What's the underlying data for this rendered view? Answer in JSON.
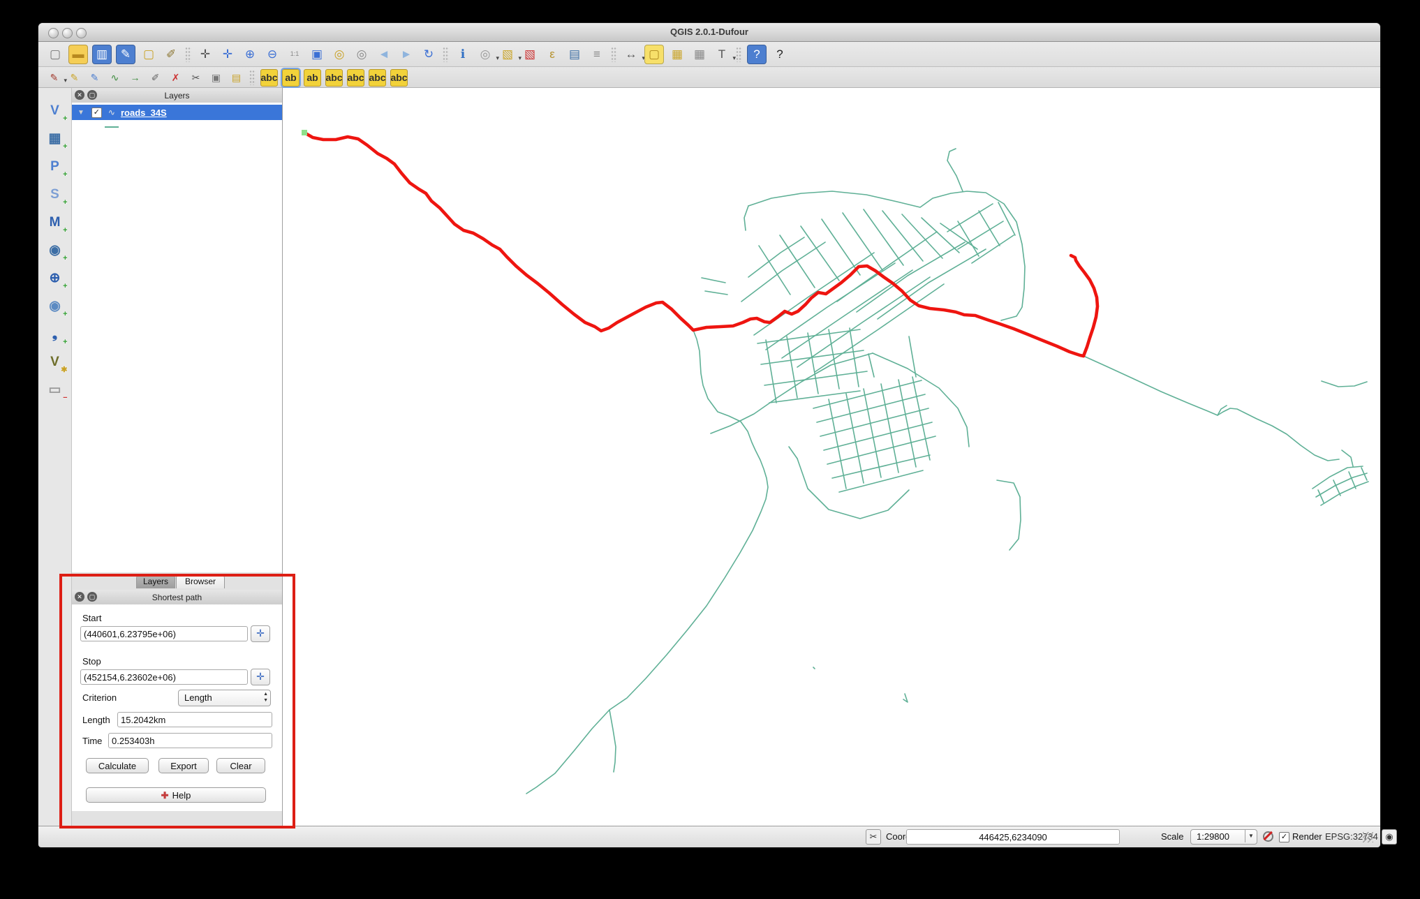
{
  "window": {
    "title": "QGIS 2.0.1-Dufour"
  },
  "colors": {
    "road": "#5fb096",
    "route": "#ee1510",
    "selection": "#3a76d9",
    "annotation": "#dd1f15",
    "start_marker": "#8de08a"
  },
  "toolbars": {
    "main": [
      {
        "n": "new-project",
        "g": "▢",
        "c": "#777"
      },
      {
        "n": "open-project",
        "g": "▬",
        "c": "#b8891f",
        "bg": "#f5ce56"
      },
      {
        "n": "save-project",
        "g": "▥",
        "c": "#ffffff",
        "bg": "#4d7fd0"
      },
      {
        "n": "save-project-as",
        "g": "✎",
        "c": "#ffffff",
        "bg": "#4d7fd0"
      },
      {
        "n": "save-as-image",
        "g": "▢",
        "c": "#c9a227"
      },
      {
        "n": "project-properties",
        "g": "✐",
        "c": "#8a7430"
      },
      {
        "sep": true
      },
      {
        "n": "pan-map",
        "g": "✛",
        "c": "#555"
      },
      {
        "n": "pan-to-selection",
        "g": "✛",
        "c": "#3b6fd4"
      },
      {
        "n": "zoom-in",
        "g": "⊕",
        "c": "#3b6fd4"
      },
      {
        "n": "zoom-out",
        "g": "⊖",
        "c": "#3b6fd4"
      },
      {
        "n": "zoom-native",
        "g": "1:1",
        "c": "#888",
        "f": 9
      },
      {
        "n": "zoom-full",
        "g": "▣",
        "c": "#3b6fd4"
      },
      {
        "n": "zoom-to-selection",
        "g": "◎",
        "c": "#c9a227"
      },
      {
        "n": "zoom-to-layer",
        "g": "◎",
        "c": "#888"
      },
      {
        "n": "zoom-last",
        "g": "◄",
        "c": "#8fb4dd"
      },
      {
        "n": "zoom-next",
        "g": "►",
        "c": "#8fb4dd"
      },
      {
        "n": "refresh",
        "g": "↻",
        "c": "#3b6fd4"
      },
      {
        "sep": true
      },
      {
        "n": "identify-features",
        "g": "ℹ",
        "c": "#2f6fc4"
      },
      {
        "n": "run-feature-action",
        "g": "◎",
        "c": "#999",
        "d": true
      },
      {
        "n": "select-features",
        "g": "▧",
        "c": "#caa52a",
        "d": true
      },
      {
        "n": "deselect-features",
        "g": "▧",
        "c": "#cc3333"
      },
      {
        "n": "select-by-expression",
        "g": "ε",
        "c": "#b5912c"
      },
      {
        "n": "attribute-table",
        "g": "▤",
        "c": "#3c6ea5"
      },
      {
        "n": "field-calculator",
        "g": "≡",
        "c": "#888"
      },
      {
        "sep": true
      },
      {
        "n": "measure",
        "g": "↔",
        "c": "#555",
        "d": true
      },
      {
        "n": "map-tips",
        "g": "▢",
        "c": "#b08b1f",
        "bg": "#f7e06a"
      },
      {
        "n": "new-bookmark",
        "g": "▦",
        "c": "#caa52a"
      },
      {
        "n": "show-bookmarks",
        "g": "▦",
        "c": "#888"
      },
      {
        "n": "text-annotation",
        "g": "T",
        "c": "#555",
        "d": true
      },
      {
        "sep": true
      },
      {
        "n": "help-contents",
        "g": "?",
        "c": "#ffffff",
        "bg": "#4d7fd0"
      },
      {
        "n": "whats-this",
        "g": "?",
        "c": "#222"
      }
    ],
    "edit": [
      {
        "n": "current-edits",
        "g": "✎",
        "c": "#a23b2e",
        "d": true
      },
      {
        "n": "toggle-editing",
        "g": "✎",
        "c": "#caa52a"
      },
      {
        "n": "save-layer-edits",
        "g": "✎",
        "c": "#4d7fd0"
      },
      {
        "n": "add-feature",
        "g": "∿",
        "c": "#3a8a3a"
      },
      {
        "n": "move-feature",
        "g": "→",
        "c": "#3a8a3a"
      },
      {
        "n": "node-tool",
        "g": "✐",
        "c": "#666"
      },
      {
        "n": "delete-selected",
        "g": "✗",
        "c": "#cc3333"
      },
      {
        "n": "cut-features",
        "g": "✂",
        "c": "#555"
      },
      {
        "n": "copy-features",
        "g": "▣",
        "c": "#777"
      },
      {
        "n": "paste-features",
        "g": "▤",
        "c": "#c9a227"
      },
      {
        "sep": true
      },
      {
        "n": "labeling",
        "g": "abc",
        "c": "#333",
        "bg": "#f2d23a",
        "tag": true
      },
      {
        "n": "label-pin-selected",
        "g": "ab",
        "c": "#333",
        "bg": "#f2d23a",
        "tag": true,
        "sel": true
      },
      {
        "n": "label-pin",
        "g": "ab",
        "c": "#333",
        "bg": "#f2d23a",
        "tag": true
      },
      {
        "n": "label-show-hide",
        "g": "abc",
        "c": "#333",
        "bg": "#f2d23a",
        "tag": true
      },
      {
        "n": "label-move",
        "g": "abc",
        "c": "#333",
        "bg": "#f2d23a",
        "tag": true
      },
      {
        "n": "label-rotate",
        "g": "abc",
        "c": "#333",
        "bg": "#f2d23a",
        "tag": true
      },
      {
        "n": "label-properties",
        "g": "abc",
        "c": "#333",
        "bg": "#f2d23a",
        "tag": true
      }
    ],
    "left": [
      {
        "n": "add-vector-layer",
        "g": "V",
        "c": "#4d7fd0",
        "badge": "+",
        "bc": "#2f9e2f"
      },
      {
        "n": "add-raster-layer",
        "g": "▦",
        "c": "#3c6ea5",
        "badge": "+",
        "bc": "#2f9e2f"
      },
      {
        "n": "add-postgis-layer",
        "g": "P",
        "c": "#4d7fd0",
        "badge": "+",
        "bc": "#2f9e2f"
      },
      {
        "n": "add-spatialite-layer",
        "g": "S",
        "c": "#7d9fd4",
        "badge": "+",
        "bc": "#2f9e2f"
      },
      {
        "n": "add-mssql-layer",
        "g": "M",
        "c": "#2d5fae",
        "badge": "+",
        "bc": "#2f9e2f"
      },
      {
        "n": "add-wms-layer",
        "g": "◉",
        "c": "#3c6ea5",
        "badge": "+",
        "bc": "#2f9e2f"
      },
      {
        "n": "add-wcs-layer",
        "g": "⊕",
        "c": "#2d5fae",
        "badge": "+",
        "bc": "#2f9e2f"
      },
      {
        "n": "add-wfs-layer",
        "g": "◉",
        "c": "#5b8ac2",
        "badge": "+",
        "bc": "#2f9e2f"
      },
      {
        "n": "add-delimited-text-layer",
        "g": "❟",
        "c": "#2d5fae",
        "badge": "+",
        "bc": "#2f9e2f"
      },
      {
        "n": "new-shapefile-layer",
        "g": "V",
        "c": "#6e6e2a",
        "badge": "✱",
        "bc": "#c9a227"
      },
      {
        "n": "remove-layer",
        "g": "▭",
        "c": "#999",
        "badge": "−",
        "bc": "#cc3333"
      }
    ]
  },
  "layers_panel": {
    "title": "Layers",
    "layer_name": "roads_34S",
    "checkbox": "✓"
  },
  "dock_tabs": {
    "layers": "Layers",
    "browser": "Browser"
  },
  "shortest_path": {
    "title": "Shortest path",
    "start_label": "Start",
    "start_value": "(440601,6.23795e+06)",
    "stop_label": "Stop",
    "stop_value": "(452154,6.23602e+06)",
    "criterion_label": "Criterion",
    "criterion_value": "Length",
    "length_label": "Length",
    "length_value": "15.2042km",
    "time_label": "Time",
    "time_value": "0.253403h",
    "calculate_label": "Calculate",
    "export_label": "Export",
    "clear_label": "Clear",
    "help_label": "Help"
  },
  "status_bar": {
    "coordinate_label": "Coordinate:",
    "coordinate_value": "446425,6234090",
    "scale_label": "Scale",
    "scale_value": "1:29800",
    "render_label": "Render",
    "render_checked": "✓",
    "crs": "EPSG:32734"
  },
  "map": {
    "start_marker": [
      436,
      190
    ],
    "route": [
      "436,190 448,197 463,200 481,200 498,196 513,199 526,208 541,220 554,227 565,235 575,248 587,262 600,271 610,277 618,288 630,298 641,310 651,321 664,330 678,334 692,342 705,351 716,357 726,368 739,381 754,394 770,406 787,420 805,436 822,450 838,462 852,468 861,474 872,470 884,462 897,455 910,448 925,440 940,434 949,433 962,443 975,456 986,466 993,473 1012,469 1032,468 1050,467 1064,462 1075,457 1084,456 1095,461 1103,462 1114,454 1124,446 1134,450 1143,446 1154,436 1162,427 1172,419 1183,421 1194,413 1205,405 1218,394 1230,382 1242,381 1254,388 1266,397 1279,406 1292,417 1304,430 1316,438 1332,442 1352,444 1369,447 1381,451 1397,452 1414,458 1432,464 1452,471 1472,479 1494,488 1514,496 1532,504 1547,509 1552,510",
      "1552,510 1557,497 1561,484 1566,469 1570,454 1572,439 1571,426 1567,413 1561,401 1553,390 1546,381 1541,373 1540,369 1534,366"
    ],
    "roads": [
      "993,473 998,486 1002,503 1003,519 1004,535 1007,552 1014,571 1028,590 1044,596 1061,604 1071,618 1077,634 1082,645 1089,659 1094,672 1098,685 1100,698 1097,715 1090,733 1078,760 1060,792 1038,828 1012,868 985,902 955,938 925,972 898,1000 873,1017 848,1044 822,1076 795,1108 768,1128 754,1137",
      "873,1017 878,1045 882,1070 881,1092 879,1106",
      "1018,621 1046,610 1080,593 1113,570 1148,547 1190,523 1222,514 1250,506",
      "1552,510 1583,524 1620,541 1663,561 1703,578 1730,589 1744,595 1752,590 1762,585 1772,586 1782,591 1800,600 1822,610 1843,622 1863,638 1883,652 1902,660 1918,658",
      "1744,595 1749,586 1757,581",
      "1893,546 1917,554 1940,553 1958,547",
      "1880,700 1905,683 1930,670 1952,668",
      "1885,712 1912,696 1938,684 1958,678",
      "1892,724 1918,708 1944,696 1960,690",
      "1888,702 1896,720",
      "1910,688 1920,710",
      "1932,676 1942,700",
      "1950,670 1958,688",
      "1922,645 1935,655 1938,668",
      "1428,688 1452,692 1461,712 1462,745 1459,772 1446,788",
      "1072,295 1105,284 1148,277 1192,274 1241,279 1285,289 1318,297 1336,284 1362,277 1385,274 1412,276 1438,292 1456,318 1464,350 1468,382 1467,413 1464,440 1456,453 1434,459",
      "1379,274 1370,252 1357,230 1360,217 1369,213",
      "1072,295 1066,312 1068,330",
      "1080,480 1160,424 1252,362",
      "1097,501 1185,440 1282,377",
      "1120,513 1210,452 1307,387",
      "1142,526 1235,462 1332,397",
      "1167,533 1258,472 1352,407",
      "1062,432 1120,388 1182,347",
      "1072,397 1118,362 1152,340",
      "1199,432 1270,382 1342,332",
      "1227,447 1300,395 1382,347",
      "1257,457 1330,405 1412,357",
      "1087,352 1132,422",
      "1117,337 1167,412",
      "1147,324 1202,402",
      "1177,314 1232,394",
      "1207,305 1264,387",
      "1237,300 1294,380",
      "1264,302 1322,374",
      "1292,307 1350,370",
      "1320,312 1374,362",
      "1347,320 1400,357",
      "1085,492 1232,472",
      "1090,522 1237,502",
      "1095,552 1242,532",
      "1102,577 1232,560",
      "1097,487 1112,577",
      "1127,482 1142,570",
      "1157,477 1172,564",
      "1187,472 1202,557",
      "1217,470 1230,554",
      "1165,585 1320,545",
      "1170,605 1325,565",
      "1175,625 1330,585",
      "1180,645 1335,605",
      "1185,665 1340,625",
      "1192,685 1332,652",
      "1202,705 1322,674",
      "1187,572 1212,700",
      "1212,564 1237,692",
      "1237,557 1262,684",
      "1262,550 1287,677",
      "1287,544 1312,669",
      "1307,540 1332,659",
      "1142,657 1157,700 1187,730 1232,743 1272,731 1302,702",
      "1130,640 1142,657",
      "1244,507 1252,540",
      "1302,482 1312,540",
      "1250,506 1300,528 1345,556 1372,585 1385,612 1388,640",
      "1357,332 1422,292",
      "1372,357 1437,317",
      "1392,377 1452,337",
      "1372,317 1402,367",
      "1402,302 1432,352",
      "1430,290 1454,337",
      "1005,398 1039,405",
      "1010,417 1042,422",
      "1165,956 1167,958",
      "1296,994 1300,1006 1294,1002"
    ]
  }
}
